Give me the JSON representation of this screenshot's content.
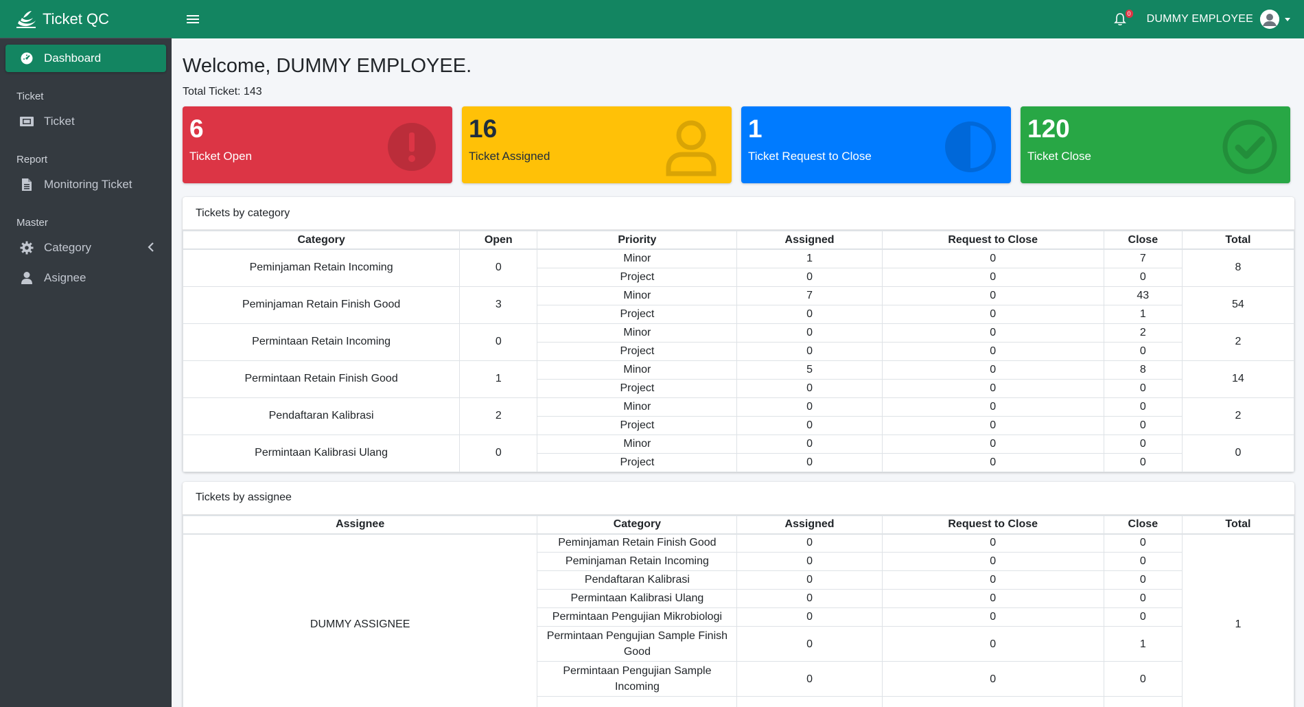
{
  "app": {
    "title": "Ticket QC"
  },
  "sidebar": {
    "dashboard": "Dashboard",
    "sections": [
      {
        "header": "Ticket",
        "items": [
          {
            "label": "Ticket",
            "icon": "ticket-icon"
          }
        ]
      },
      {
        "header": "Report",
        "items": [
          {
            "label": "Monitoring Ticket",
            "icon": "file-icon"
          }
        ]
      },
      {
        "header": "Master",
        "items": [
          {
            "label": "Category",
            "icon": "gear-icon"
          },
          {
            "label": "Asignee",
            "icon": "user-icon"
          }
        ]
      }
    ]
  },
  "topbar": {
    "notifications": "0",
    "user": "DUMMY EMPLOYEE"
  },
  "welcome": "Welcome, DUMMY EMPLOYEE.",
  "total_ticket": "Total Ticket: 143",
  "boxes": [
    {
      "value": "6",
      "label": "Ticket Open",
      "color": "#dc3545"
    },
    {
      "value": "16",
      "label": "Ticket Assigned",
      "color": "#ffc107"
    },
    {
      "value": "1",
      "label": "Ticket Request to Close",
      "color": "#007bff"
    },
    {
      "value": "120",
      "label": "Ticket Close",
      "color": "#28a745"
    }
  ],
  "category_table": {
    "title": "Tickets by category",
    "headers": [
      "Category",
      "Open",
      "Priority",
      "Assigned",
      "Request to Close",
      "Close",
      "Total"
    ],
    "rows": [
      {
        "category": "Peminjaman Retain Incoming",
        "open": "0",
        "total": "8",
        "minor": {
          "priority": "Minor",
          "assigned": "1",
          "rtc": "0",
          "close": "7"
        },
        "project": {
          "priority": "Project",
          "assigned": "0",
          "rtc": "0",
          "close": "0"
        }
      },
      {
        "category": "Peminjaman Retain Finish Good",
        "open": "3",
        "total": "54",
        "minor": {
          "priority": "Minor",
          "assigned": "7",
          "rtc": "0",
          "close": "43"
        },
        "project": {
          "priority": "Project",
          "assigned": "0",
          "rtc": "0",
          "close": "1"
        }
      },
      {
        "category": "Permintaan Retain Incoming",
        "open": "0",
        "total": "2",
        "minor": {
          "priority": "Minor",
          "assigned": "0",
          "rtc": "0",
          "close": "2"
        },
        "project": {
          "priority": "Project",
          "assigned": "0",
          "rtc": "0",
          "close": "0"
        }
      },
      {
        "category": "Permintaan Retain Finish Good",
        "open": "1",
        "total": "14",
        "minor": {
          "priority": "Minor",
          "assigned": "5",
          "rtc": "0",
          "close": "8"
        },
        "project": {
          "priority": "Project",
          "assigned": "0",
          "rtc": "0",
          "close": "0"
        }
      },
      {
        "category": "Pendaftaran Kalibrasi",
        "open": "2",
        "total": "2",
        "minor": {
          "priority": "Minor",
          "assigned": "0",
          "rtc": "0",
          "close": "0"
        },
        "project": {
          "priority": "Project",
          "assigned": "0",
          "rtc": "0",
          "close": "0"
        }
      },
      {
        "category": "Permintaan Kalibrasi Ulang",
        "open": "0",
        "total": "0",
        "minor": {
          "priority": "Minor",
          "assigned": "0",
          "rtc": "0",
          "close": "0"
        },
        "project": {
          "priority": "Project",
          "assigned": "0",
          "rtc": "0",
          "close": "0"
        }
      }
    ]
  },
  "assignee_table": {
    "title": "Tickets by assignee",
    "headers": [
      "Assignee",
      "Category",
      "Assigned",
      "Request to Close",
      "Close",
      "Total"
    ],
    "assignee": "DUMMY ASSIGNEE",
    "total": "1",
    "rows": [
      {
        "category": "Peminjaman Retain Finish Good",
        "assigned": "0",
        "rtc": "0",
        "close": "0"
      },
      {
        "category": "Peminjaman Retain Incoming",
        "assigned": "0",
        "rtc": "0",
        "close": "0"
      },
      {
        "category": "Pendaftaran Kalibrasi",
        "assigned": "0",
        "rtc": "0",
        "close": "0"
      },
      {
        "category": "Permintaan Kalibrasi Ulang",
        "assigned": "0",
        "rtc": "0",
        "close": "0"
      },
      {
        "category": "Permintaan Pengujian Mikrobiologi",
        "assigned": "0",
        "rtc": "0",
        "close": "0"
      },
      {
        "category": "Permintaan Pengujian Sample Finish Good",
        "assigned": "0",
        "rtc": "0",
        "close": "1"
      },
      {
        "category": "Permintaan Pengujian Sample Incoming",
        "assigned": "0",
        "rtc": "0",
        "close": "0"
      }
    ]
  }
}
